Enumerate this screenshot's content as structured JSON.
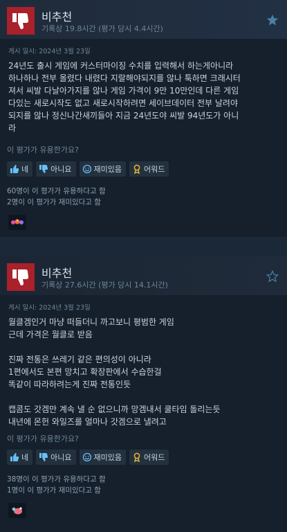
{
  "reviews": [
    {
      "verdict": "비추천",
      "hours": "기록상 19.8시간 (평가 당시 4.4시간)",
      "posted": "게시 일시: 2024년 3월 23일",
      "body": "24년도 출시 게임에 커스터마이징 수치를 입력해서 하는게아니라\n하나하나 전부 올렸다 내렸다 지랄해야되지를 않나 툭하면 크래시터\n져서 씨발 다날아가지를 않나 게임 가격이 9만 10만인데 다른 게임\n다있는 새로시작도 없고 새로시작하려면 세이브데이터 전부 날려야\n되지를 않나 정신나간새끼들아 지금 24년도야 씨발 94년도가 아니\n라",
      "helpful_question": "이 평가가 유용한가요?",
      "buttons": {
        "yes": "네",
        "no": "아니요",
        "funny": "재미있음",
        "award": "어워드"
      },
      "helpful_count": "60명이 이 평가가 유용하다고 함",
      "funny_count": "2명이 이 평가가 재미있다고 함",
      "flag_icon": "star-icon",
      "award_icon": "award-badge-icon"
    },
    {
      "verdict": "비추천",
      "hours": "기록상 27.6시간 (평가 당시 14.1시간)",
      "posted": "게시 일시: 2024년 3월 23일",
      "body": "월클겜인거 마냥 떠들더니 까고보니 평범한 게임\n근데 가격은 월클로 받음\n\n진짜 전통은 쓰레기 같은 편의성이 아니라\n1편에서도 본편 망치고 확장판에서 수습한걸\n똑같이 따라하려는게 진짜 전통인듯\n\n캡콤도 갓겜만 계속 낼 순 없으니까 망겜내서 쿨타임 돌리는듯\n내년에 몬헌 와일즈를 얼마나 갓겜으로 낼려고",
      "helpful_question": "이 평가가 유용한가요?",
      "buttons": {
        "yes": "네",
        "no": "아니요",
        "funny": "재미있음",
        "award": "어워드"
      },
      "helpful_count": "38명이 이 평가가 유용하다고 함",
      "funny_count": "1명이 이 평가가 재미있다고 함",
      "flag_icon": "outline-star-icon",
      "award_icon": "award-badge-icon"
    }
  ],
  "colors": {
    "thumb_bg": "#a8212b",
    "award_gold": "#e7b836",
    "panel": "#16202d"
  }
}
